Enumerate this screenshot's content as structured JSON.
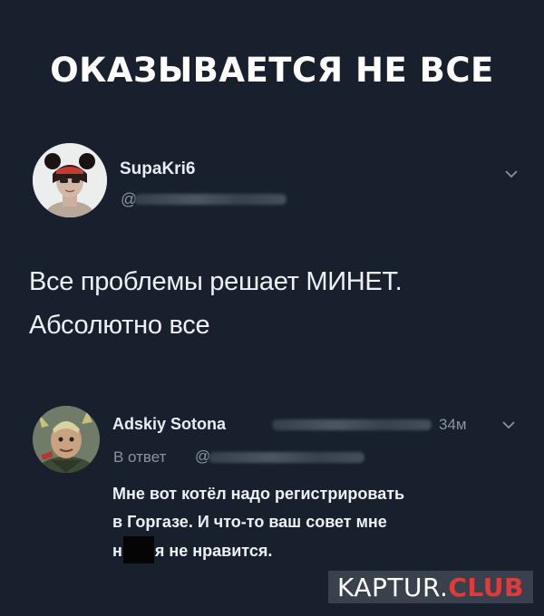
{
  "meme_title": "ОКАЗЫВАЕТСЯ НЕ ВСЕ",
  "tweet": {
    "author": "SupaKri6",
    "handle_prefix": "@",
    "text_line1": "Все проблемы решает МИНЕТ.",
    "text_line2": "Абсолютно все"
  },
  "reply": {
    "author": "Adskiy Sotona",
    "time": "34м",
    "reply_to_label": "В ответ",
    "handle_prefix": "@",
    "text_line1": "Мне вот котёл надо регистрировать",
    "text_line2": "в Горгазе. И что-то ваш совет мне",
    "text_line3_start": "н",
    "text_line3_end": "я не нравится."
  },
  "watermark": {
    "main": "KAPTUR.",
    "accent": "CLUB",
    "accent_color": "#e23a3a"
  },
  "icons": [
    "avatar",
    "chevron-down-icon"
  ],
  "colors": {
    "background": "#17202c",
    "text": "#eef1f4",
    "muted": "#8a94a1"
  }
}
